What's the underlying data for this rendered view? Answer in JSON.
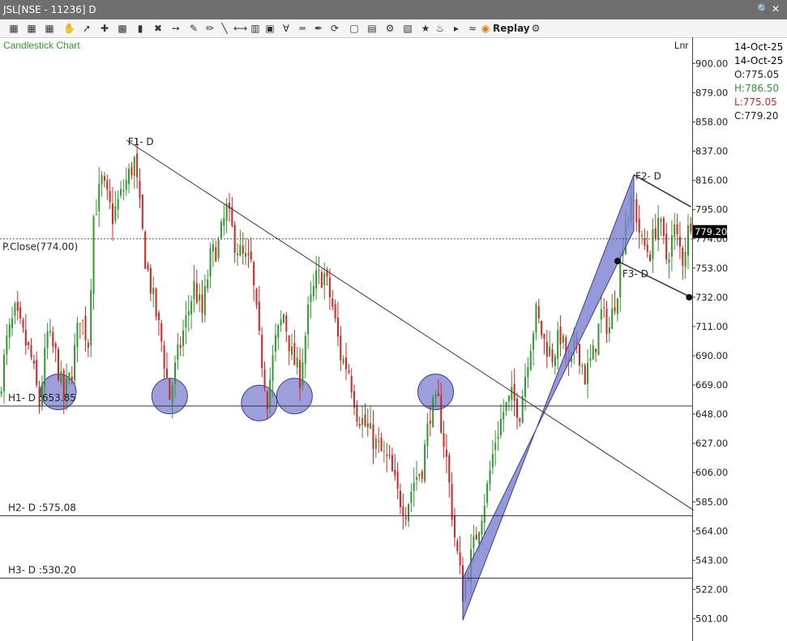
{
  "window": {
    "title": "JSL[NSE - 11236] D"
  },
  "toolbar": {
    "replay_label": "Replay"
  },
  "colors": {
    "bull": "#2e9b2e",
    "bear": "#e02020",
    "highlight": "#7b7fcf",
    "line": "#333333",
    "grid_dash": "#555555"
  },
  "icons": [
    "search-icon",
    "close-icon",
    "calendar-icon",
    "hand-icon",
    "cursor-icon",
    "crosshair-icon",
    "pencil-icon",
    "line-icon",
    "hline-icon",
    "bar-chart-icon",
    "cube-icon",
    "zoom-icon",
    "star-icon",
    "settings-icon"
  ],
  "ohlc_panel": {
    "date1": "14-Oct-25",
    "date2": "14-Oct-25",
    "open": "O:775.05",
    "high": "H:786.50",
    "low": "L:775.05",
    "close": "C:779.20",
    "open_color": "#222222",
    "high_color": "#2e9b2e",
    "low_color": "#e02020",
    "close_color": "#222222"
  },
  "chart_data": {
    "type": "candlestick",
    "title": "Candlestick Chart",
    "scale_label": "Lnr",
    "ylim": [
      492,
      906
    ],
    "y_ticks": [
      900,
      879,
      858,
      837,
      816,
      795,
      774,
      753,
      732,
      711,
      690,
      669,
      648,
      627,
      606,
      585,
      564,
      543,
      522,
      501
    ],
    "last_price": 779.2,
    "last_price_label": "779.20",
    "x_count": 255,
    "anchors": [
      [
        0,
        660
      ],
      [
        3,
        700
      ],
      [
        6,
        720
      ],
      [
        12,
        688
      ],
      [
        15,
        655
      ],
      [
        18,
        705
      ],
      [
        21,
        690
      ],
      [
        24,
        660
      ],
      [
        27,
        680
      ],
      [
        30,
        720
      ],
      [
        33,
        700
      ],
      [
        35,
        790
      ],
      [
        38,
        815
      ],
      [
        42,
        790
      ],
      [
        46,
        810
      ],
      [
        50,
        830
      ],
      [
        54,
        760
      ],
      [
        57,
        730
      ],
      [
        60,
        700
      ],
      [
        63,
        660
      ],
      [
        66,
        690
      ],
      [
        69,
        715
      ],
      [
        72,
        740
      ],
      [
        75,
        720
      ],
      [
        78,
        760
      ],
      [
        81,
        770
      ],
      [
        84,
        795
      ],
      [
        87,
        772
      ],
      [
        90,
        760
      ],
      [
        93,
        755
      ],
      [
        96,
        700
      ],
      [
        99,
        660
      ],
      [
        102,
        700
      ],
      [
        105,
        720
      ],
      [
        108,
        690
      ],
      [
        111,
        675
      ],
      [
        114,
        720
      ],
      [
        117,
        745
      ],
      [
        120,
        748
      ],
      [
        123,
        725
      ],
      [
        126,
        690
      ],
      [
        129,
        680
      ],
      [
        132,
        650
      ],
      [
        135,
        640
      ],
      [
        138,
        630
      ],
      [
        141,
        620
      ],
      [
        144,
        612
      ],
      [
        147,
        590
      ],
      [
        150,
        580
      ],
      [
        153,
        600
      ],
      [
        156,
        610
      ],
      [
        159,
        650
      ],
      [
        162,
        655
      ],
      [
        165,
        615
      ],
      [
        168,
        560
      ],
      [
        171,
        520
      ],
      [
        174,
        545
      ],
      [
        177,
        570
      ],
      [
        180,
        595
      ],
      [
        183,
        630
      ],
      [
        186,
        650
      ],
      [
        189,
        660
      ],
      [
        192,
        650
      ],
      [
        195,
        690
      ],
      [
        198,
        720
      ],
      [
        201,
        700
      ],
      [
        204,
        690
      ],
      [
        207,
        705
      ],
      [
        210,
        680
      ],
      [
        213,
        700
      ],
      [
        216,
        675
      ],
      [
        219,
        690
      ],
      [
        222,
        720
      ],
      [
        225,
        710
      ],
      [
        228,
        740
      ],
      [
        231,
        790
      ],
      [
        234,
        800
      ],
      [
        237,
        770
      ],
      [
        240,
        765
      ],
      [
        243,
        790
      ],
      [
        246,
        760
      ],
      [
        249,
        780
      ],
      [
        252,
        760
      ],
      [
        254,
        779.2
      ]
    ],
    "hlines": [
      {
        "label": "H1- D :653.85",
        "value": 653.85
      },
      {
        "label": "H2- D :575.08",
        "value": 575.08
      },
      {
        "label": "H3- D :530.20",
        "value": 530.2
      }
    ],
    "prev_close": {
      "label": "P.Close(774.00)",
      "value": 774.0
    },
    "trendline": {
      "label": "F1- D",
      "from": [
        46,
        845
      ],
      "to": [
        255,
        579
      ]
    },
    "channel": {
      "label_top": "F2- D",
      "label_bottom": "F3- D",
      "top_from": [
        233,
        820
      ],
      "top_to": [
        254,
        797
      ],
      "bottom_from": [
        227,
        758
      ],
      "bottom_to": [
        254,
        732
      ]
    },
    "highlight_zones": [
      [
        21,
        664
      ],
      [
        62,
        661
      ],
      [
        95,
        656
      ],
      [
        108,
        661
      ],
      [
        160,
        664
      ]
    ],
    "wedge": {
      "a": [
        170,
        500
      ],
      "b": [
        233,
        820
      ],
      "c": [
        170,
        530
      ],
      "d": [
        233,
        780
      ]
    }
  }
}
